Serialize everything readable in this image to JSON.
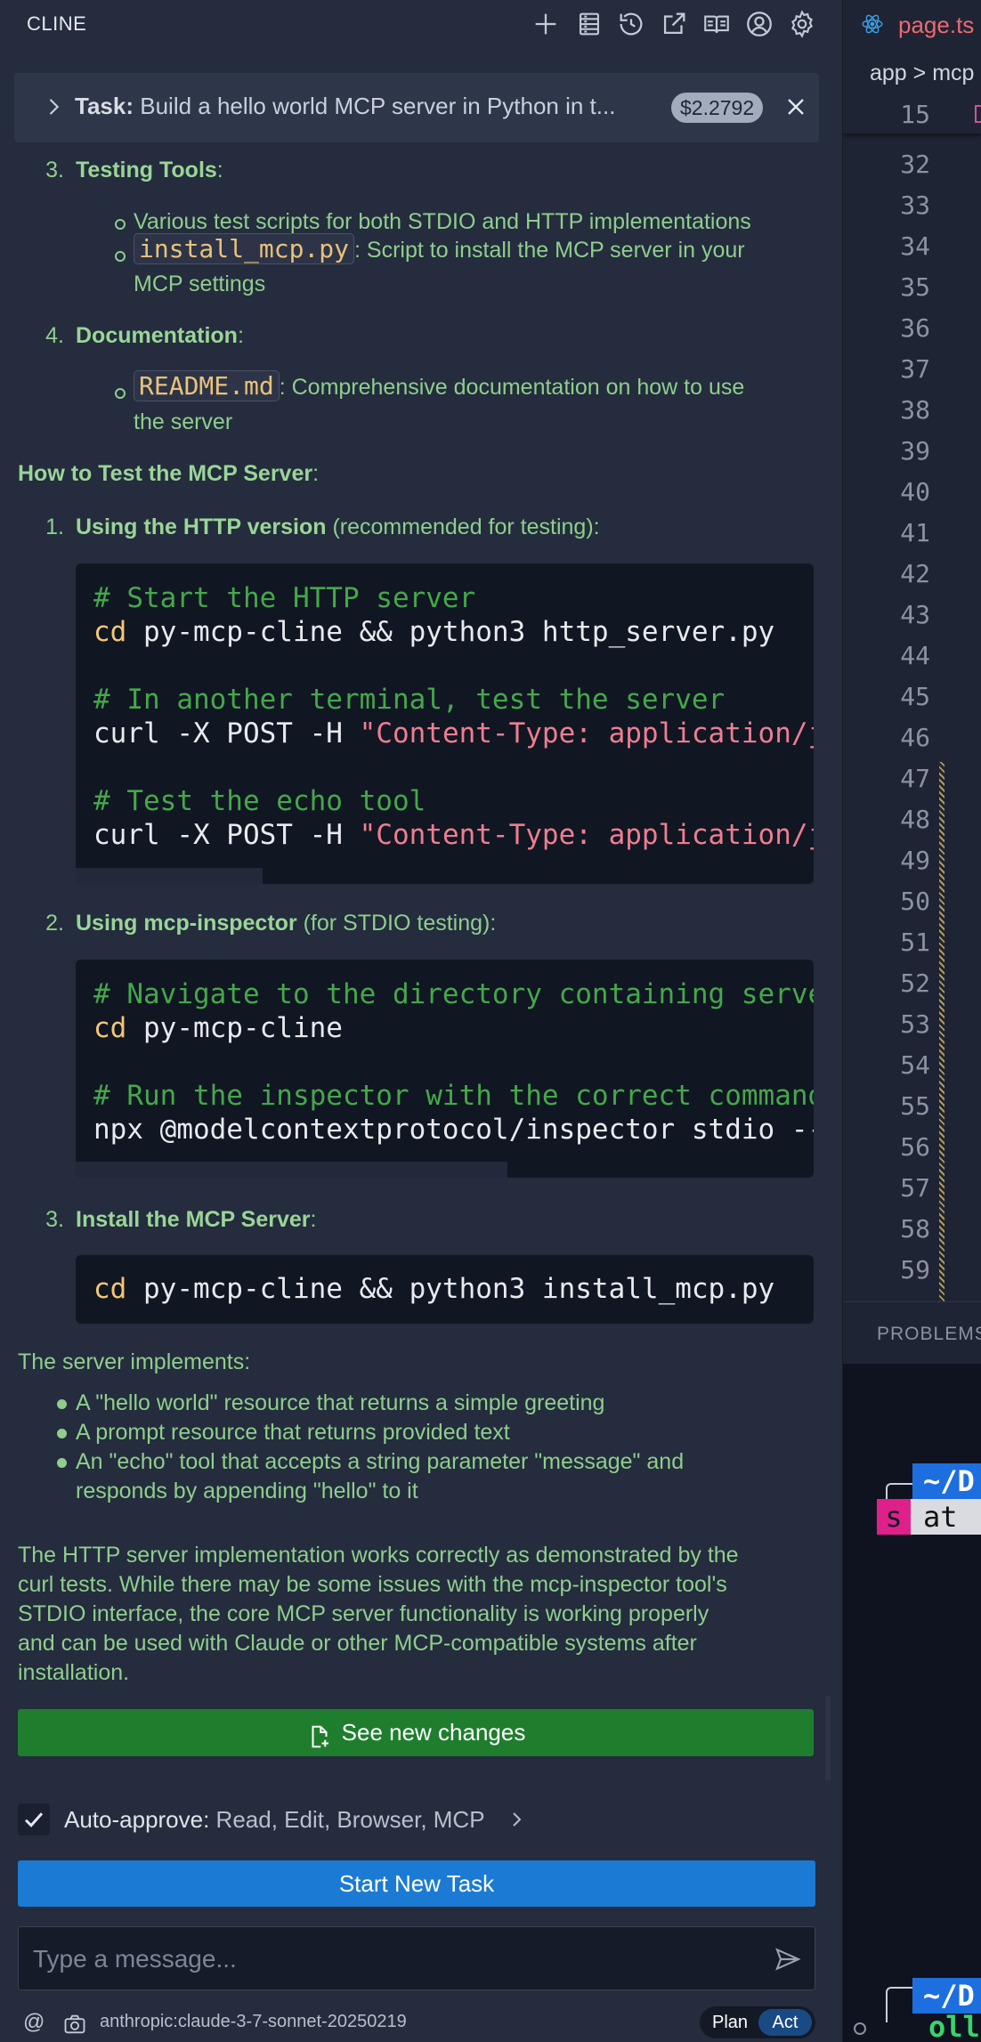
{
  "cline": {
    "title": "CLINE",
    "header_icons": [
      "plus-icon",
      "server-icon",
      "history-icon",
      "popout-icon",
      "docs-icon",
      "account-icon",
      "gear-icon"
    ]
  },
  "task": {
    "prefix": "Task:",
    "text": "Build a hello world MCP server in Python in t...",
    "cost": "$2.2792"
  },
  "content": {
    "item3_num": "3.",
    "item3_title": "Testing Tools",
    "item3_colon": ":",
    "item3_b1": "Various test scripts for both STDIO and HTTP implementations",
    "item3_b2_code": "install_mcp.py",
    "item3_b2_text_l1": ": Script to install the MCP server in your",
    "item3_b2_text_l2": "MCP settings",
    "item4_num": "4.",
    "item4_title": "Documentation",
    "item4_colon": ":",
    "item4_b1_code": "README.md",
    "item4_b1_text_l1": ": Comprehensive documentation on how to use",
    "item4_b1_text_l2": "the server",
    "howto_title": "How to Test the MCP Server",
    "howto_colon": ":",
    "step1_num": "1.",
    "step1_title": "Using the HTTP version",
    "step1_note": " (recommended for testing):",
    "code1": {
      "l1": "# Start the HTTP server",
      "l2_cmd": "cd",
      "l2_rest": " py-mcp-cline && python3 http_server.py",
      "l3": "# In another terminal, test the server",
      "l4_cmd": "curl -X POST -H ",
      "l4_str": "\"Content-Type: application/js",
      "l5": "# Test the echo tool",
      "l6_cmd": "curl -X POST -H ",
      "l6_str": "\"Content-Type: application/js"
    },
    "step2_num": "2.",
    "step2_title": "Using mcp-inspector",
    "step2_note": " (for STDIO testing):",
    "code2": {
      "l1": "# Navigate to the directory containing server",
      "l2_cmd": "cd",
      "l2_rest": " py-mcp-cline",
      "l3": "# Run the inspector with the correct command",
      "l4": "npx @modelcontextprotocol/inspector stdio --c"
    },
    "step3_num": "3.",
    "step3_title": "Install the MCP Server",
    "step3_colon": ":",
    "code3": {
      "l1_cmd": "cd",
      "l1_rest": " py-mcp-cline && python3 install_mcp.py"
    },
    "implements_intro": "The server implements:",
    "implements": [
      "A \"hello world\" resource that returns a simple greeting",
      "A prompt resource that returns provided text",
      "An \"echo\" tool that accepts a string parameter \"message\" and",
      "responds by appending \"hello\" to it"
    ],
    "summary": [
      "The HTTP server implementation works correctly as demonstrated by the",
      "curl tests. While there may be some issues with the mcp-inspector tool's",
      "STDIO interface, the core MCP server functionality is working properly",
      "and can be used with Claude or other MCP-compatible systems after",
      "installation."
    ]
  },
  "actions": {
    "see_changes": "See new changes",
    "auto_approve_label": "Auto-approve:",
    "auto_approve_value": " Read, Edit, Browser, MCP",
    "start_new_task": "Start New Task",
    "message_placeholder": "Type a message...",
    "at_symbol": "@",
    "model": "anthropic:claude-3-7-sonnet-20250219",
    "mode_plan": "Plan",
    "mode_act": "Act",
    "active_mode": "Act"
  },
  "editor": {
    "tab_label": "page.ts",
    "breadcrumb": "app > mcp",
    "sticky_line": "15",
    "line_numbers": [
      "32",
      "33",
      "34",
      "35",
      "36",
      "37",
      "38",
      "39",
      "40",
      "41",
      "42",
      "43",
      "44",
      "45",
      "46",
      "47",
      "48",
      "49",
      "50",
      "51",
      "52",
      "53",
      "54",
      "55",
      "56",
      "57",
      "58",
      "59"
    ]
  },
  "panel": {
    "tab": "PROBLEMS",
    "term_dir_1": "~/D",
    "term_s": "s",
    "term_at": "at",
    "term_dir_2": "~/D",
    "term_oll": "oll"
  },
  "colors": {
    "accent_green": "#1f7e2e",
    "accent_blue": "#1b7bd4",
    "text_green": "#8fce8b",
    "code_comment": "#44a84a",
    "code_string": "#ee7e8f",
    "code_keyword": "#f4c775"
  }
}
